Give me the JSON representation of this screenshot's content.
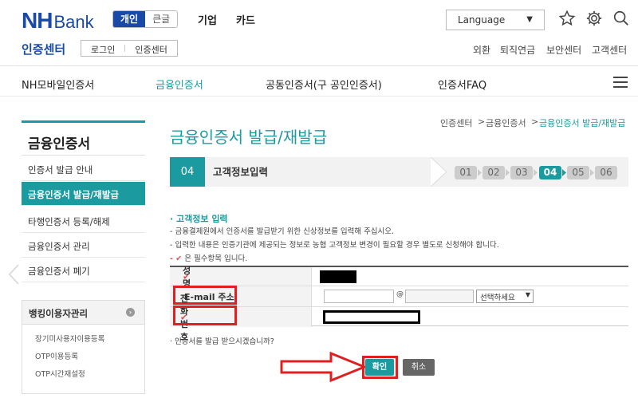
{
  "header": {
    "logo_nh": "NH",
    "logo_bank": "Bank",
    "segments": [
      "개인",
      "큰글"
    ],
    "top_nav": [
      "기업",
      "카드"
    ],
    "language": "Language",
    "sub_title": "인증센터",
    "login_links": [
      "로그인",
      "인증센터"
    ],
    "util_links": [
      "외환",
      "퇴직연금",
      "보안센터",
      "고객센터"
    ]
  },
  "main_nav": {
    "items": [
      "NH모바일인증서",
      "금융인증서",
      "공동인증서(구 공인인증서)",
      "인증서FAQ"
    ],
    "active_index": 1
  },
  "left_menu": {
    "title": "금융인증서",
    "items": [
      "인증서 발급 안내",
      "금융인증서 발급/재발급",
      "타행인증서 등록/해제",
      "금융인증서 관리",
      "금융인증서 폐기"
    ],
    "active_index": 1,
    "box_title": "뱅킹이용자관리",
    "box_items": [
      "장기미사용자이용등록",
      "OTP이용등록",
      "OTP시간재설정"
    ]
  },
  "breadcrumb": [
    "인증센터",
    "금융인증서",
    "금융인증서 발급/재발급"
  ],
  "page_title": "금융인증서 발급/재발급",
  "steps": {
    "current_number": "04",
    "current_label": "고객정보입력",
    "all": [
      "01",
      "02",
      "03",
      "04",
      "05",
      "06"
    ],
    "active_index": 3
  },
  "section": {
    "title": "· 고객정보 입력",
    "notes": [
      "- 금융결제원에서 인증서를 발급받기 위한 신상정보를 입력해 주십시오.",
      "- 입력한 내용은 인증기관에 제공되는 정보로 농협 고객정보 변경이 필요할 경우 별도로 신청해야 합니다.",
      "은 필수항목 입니다."
    ],
    "required_prefix": "- ✔"
  },
  "form": {
    "name_label": "성명",
    "email_label": "E-mail 주소",
    "email_at": "@",
    "email_domain_select": "선택하세요",
    "phone_label": "전화번호",
    "check_glyph": "✔"
  },
  "question": "· 인증서를 발급 받으시겠습니까?",
  "buttons": {
    "ok": "확인",
    "cancel": "취소"
  }
}
